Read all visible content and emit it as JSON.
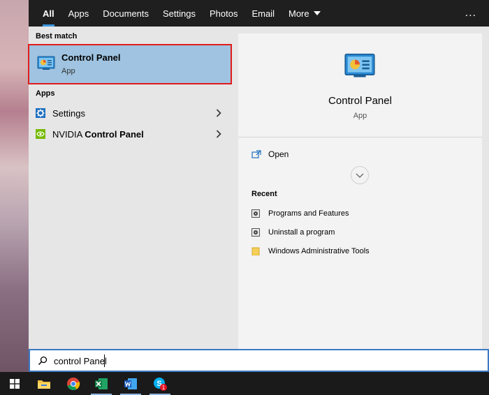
{
  "tabs": [
    "All",
    "Apps",
    "Documents",
    "Settings",
    "Photos",
    "Email",
    "More"
  ],
  "more_menu": "...",
  "left": {
    "best_match_header": "Best match",
    "best_match": {
      "title": "Control Panel",
      "subtitle": "App",
      "icon": "control-panel-icon"
    },
    "apps_header": "Apps",
    "apps": [
      {
        "label": "Settings",
        "icon": "gear-icon"
      },
      {
        "label_prefix": "NVIDIA ",
        "label_bold": "Control Panel",
        "icon": "nvidia-icon"
      }
    ]
  },
  "preview": {
    "title": "Control Panel",
    "subtitle": "App",
    "open_label": "Open",
    "recent_header": "Recent",
    "recent": [
      "Programs and Features",
      "Uninstall a program",
      "Windows Administrative Tools"
    ]
  },
  "search": {
    "value": "control Panel"
  },
  "taskbar": [
    "windows-start-icon",
    "file-explorer-icon",
    "chrome-icon",
    "excel-icon",
    "word-icon",
    "skype-icon"
  ],
  "skype_badge": "1",
  "colors": {
    "accent": "#3a96dd",
    "selection": "#9fc3e0",
    "highlight_border": "#e21b1b"
  }
}
